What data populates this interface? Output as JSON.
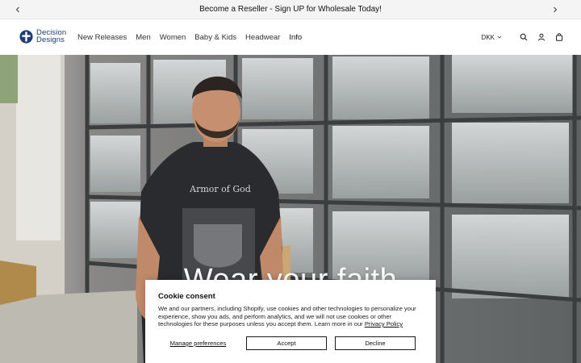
{
  "announcement": {
    "text": "Become a Reseller - Sign UP for Wholesale Today!",
    "prev_icon": "chevron-left-icon",
    "next_icon": "chevron-right-icon"
  },
  "header": {
    "logo": {
      "line1": "Decision",
      "line2": "Designs",
      "icon": "cross-emblem-icon",
      "color": "#1f3f73"
    },
    "nav": [
      {
        "label": "New Releases"
      },
      {
        "label": "Men"
      },
      {
        "label": "Women"
      },
      {
        "label": "Baby & Kids"
      },
      {
        "label": "Headwear"
      },
      {
        "label": "Info"
      }
    ],
    "currency": "DKK",
    "icons": [
      "search-icon",
      "account-icon",
      "cart-icon"
    ]
  },
  "hero": {
    "heading": "Wear your faith",
    "shirt_text": "Armor of God"
  },
  "cookie": {
    "title": "Cookie consent",
    "body": "We and our partners, including Shopify, use cookies and other technologies to personalize your experience, show you ads, and perform analytics, and we will not use cookies or other technologies for these purposes unless you accept them. Learn more in our ",
    "link": "Privacy Policy",
    "manage": "Manage preferences",
    "accept": "Accept",
    "decline": "Decline"
  }
}
